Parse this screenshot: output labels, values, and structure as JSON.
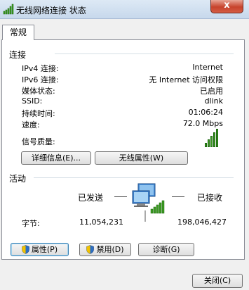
{
  "window": {
    "title": "无线网络连接 状态",
    "close_symbol": "x"
  },
  "tabs": [
    {
      "label": "常规"
    }
  ],
  "connection": {
    "heading": "连接",
    "rows": [
      {
        "label": "IPv4 连接:",
        "value": "Internet"
      },
      {
        "label": "IPv6 连接:",
        "value": "无 Internet 访问权限"
      },
      {
        "label": "媒体状态:",
        "value": "已启用"
      },
      {
        "label": "SSID:",
        "value": "dlink"
      },
      {
        "label": "持续时间:",
        "value": "01:06:24"
      },
      {
        "label": "速度:",
        "value": "72.0 Mbps"
      }
    ],
    "signal_label": "信号质量:",
    "signal_bars_filled": 5,
    "signal_bars_total": 5,
    "details_button": "详细信息(E)...",
    "wireless_props_button": "无线属性(W)"
  },
  "activity": {
    "heading": "活动",
    "sent_label": "已发送",
    "received_label": "已接收",
    "bytes_label": "字节:",
    "bytes_sent": "11,054,231",
    "bytes_received": "198,046,427"
  },
  "actions": {
    "properties": "属性(P)",
    "disable": "禁用(D)",
    "diagnose": "诊断(G)"
  },
  "footer": {
    "close_button": "关闭(C)"
  },
  "colors": {
    "signal": "#3c9a22",
    "panel_bg": "#ffffff",
    "window_bg": "#f0f0f0"
  }
}
